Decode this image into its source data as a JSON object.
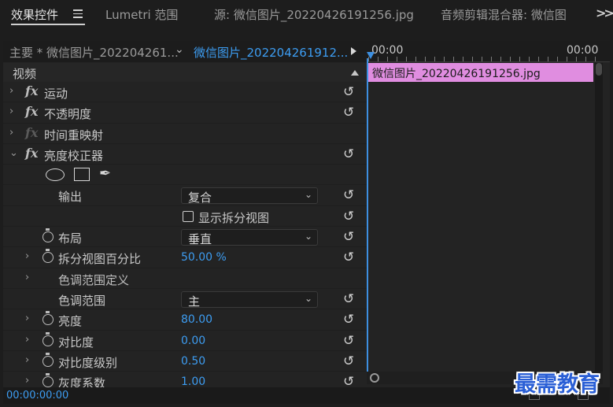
{
  "tabs": [
    {
      "label": "效果控件",
      "active": true
    },
    {
      "label": "Lumetri 范围",
      "active": false
    },
    {
      "label": "源: 微信图片_20220426191256.jpg",
      "active": false
    },
    {
      "label": "音频剪辑混合器: 微信图",
      "active": false
    }
  ],
  "sequence": {
    "master_label": "主要 * 微信图片_202204261...",
    "clip_label": "微信图片_202204261912..."
  },
  "section": {
    "label": "视频"
  },
  "effects": {
    "motion": "运动",
    "opacity": "不透明度",
    "time_remap": "时间重映射",
    "luma_corrector": "亮度校正器"
  },
  "params": {
    "output": {
      "label": "输出",
      "value": "复合"
    },
    "split_view": {
      "label": "显示拆分视图"
    },
    "layout": {
      "label": "布局",
      "value": "垂直"
    },
    "split_percent": {
      "label": "拆分视图百分比",
      "value": "50.00 %"
    },
    "tonal_range_def": {
      "label": "色调范围定义"
    },
    "tonal_range": {
      "label": "色调范围",
      "value": "主"
    },
    "brightness": {
      "label": "亮度",
      "value": "80.00"
    },
    "contrast": {
      "label": "对比度",
      "value": "0.00"
    },
    "contrast_level": {
      "label": "对比度级别",
      "value": "0.50"
    },
    "gamma": {
      "label": "灰度系数",
      "value": "1.00"
    }
  },
  "timeline": {
    "start_time": "00:00",
    "end_time": "00:00",
    "clip_name": "微信图片_20220426191256.jpg"
  },
  "footer": {
    "timecode": "00:00:00:00"
  },
  "watermark": "最需教育",
  "colors": {
    "accent": "#3d9df2",
    "clip": "#e08de0"
  }
}
